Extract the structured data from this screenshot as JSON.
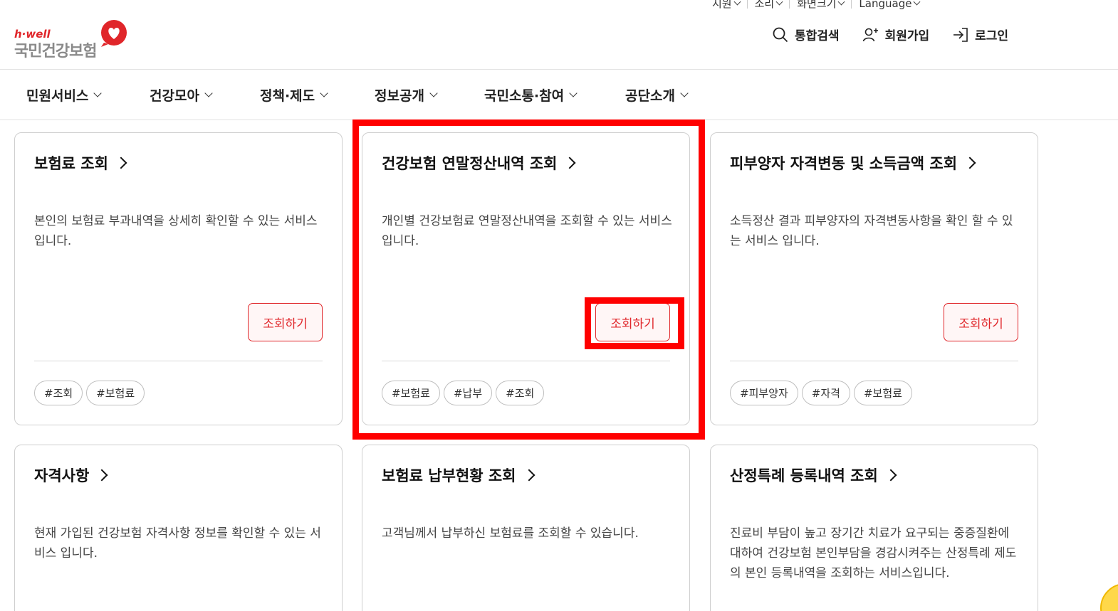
{
  "utility": {
    "items": [
      "지원",
      "소리",
      "화면크기",
      "Language"
    ]
  },
  "logo": {
    "tagline": "h·well",
    "name": "국민건강보험"
  },
  "header_actions": {
    "search": "통합검색",
    "signup": "회원가입",
    "login": "로그인"
  },
  "gnb": [
    "민원서비스",
    "건강모아",
    "정책·제도",
    "정보공개",
    "국민소통·참여",
    "공단소개"
  ],
  "cards": [
    {
      "title": "보험료 조회",
      "desc": "본인의 보험료 부과내역을 상세히 확인할 수 있는 서비스 입니다.",
      "button": "조회하기",
      "tags": [
        "#조회",
        "#보험료"
      ]
    },
    {
      "title": "건강보험 연말정산내역 조회",
      "desc": "개인별 건강보험료 연말정산내역을 조회할 수 있는 서비스입니다.",
      "button": "조회하기",
      "tags": [
        "#보험료",
        "#납부",
        "#조회"
      ]
    },
    {
      "title": "피부양자 자격변동 및 소득금액 조회",
      "desc": "소득정산 결과 피부양자의 자격변동사항을 확인 할 수 있는 서비스 입니다.",
      "button": "조회하기",
      "tags": [
        "#피부양자",
        "#자격",
        "#보험료"
      ]
    },
    {
      "title": "자격사항",
      "desc": "현재 가입된 건강보험 자격사항 정보를 확인할 수 있는 서비스 입니다."
    },
    {
      "title": "보험료 납부현황 조회",
      "desc": "고객님께서 납부하신 보험료를 조회할 수 있습니다."
    },
    {
      "title": "산정특례 등록내역 조회",
      "desc": "진료비 부담이 높고 장기간 치료가 요구되는 중증질환에 대하여 건강보험 본인부담을 경감시켜주는 산정특례 제도의 본인 등록내역을 조회하는 서비스입니다."
    }
  ],
  "colors": {
    "brand_red": "#e0262a",
    "highlight": "#ff0000"
  }
}
